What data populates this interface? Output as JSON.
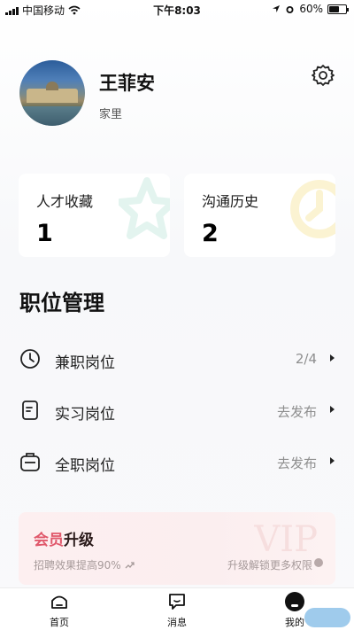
{
  "status_bar": {
    "carrier": "中国移动",
    "time": "下午8:03",
    "battery": "60%",
    "battery_level": 0.6
  },
  "profile": {
    "name": "王菲安",
    "location": "家里"
  },
  "stats": [
    {
      "label": "人才收藏",
      "value": "1"
    },
    {
      "label": "沟通历史",
      "value": "2"
    }
  ],
  "section": {
    "title": "职位管理",
    "items": [
      {
        "label": "兼职岗位",
        "value": "2/4",
        "icon": "clock-icon"
      },
      {
        "label": "实习岗位",
        "value": "去发布",
        "icon": "document-icon"
      },
      {
        "label": "全职岗位",
        "value": "去发布",
        "icon": "briefcase-icon"
      }
    ]
  },
  "vip": {
    "title_a": "会员",
    "title_b": "升级",
    "subtitle": "招聘效果提高90%",
    "cta": "升级解锁更多权限",
    "watermark": "VIP",
    "accent": "#e0586b"
  },
  "tabs": [
    {
      "label": "首页",
      "icon": "home-icon"
    },
    {
      "label": "消息",
      "icon": "message-icon"
    },
    {
      "label": "我的",
      "icon": "profile-icon"
    }
  ]
}
